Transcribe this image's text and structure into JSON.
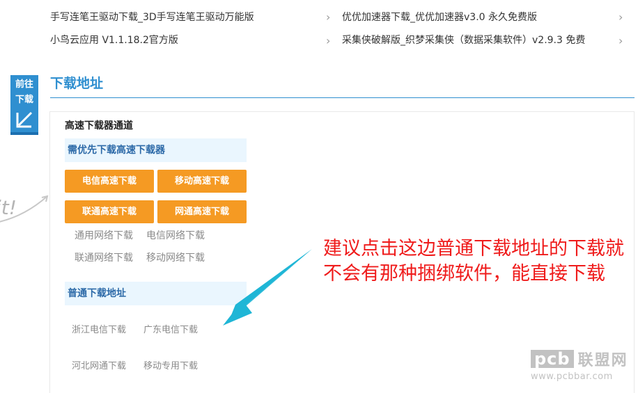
{
  "related_links": [
    {
      "label": "手写连笔王驱动下载_3D手写连笔王驱动万能版"
    },
    {
      "label": "优优加速器下载_优优加速器v3.0 永久免费版"
    },
    {
      "label": "小鸟云应用 V1.1.18.2官方版"
    },
    {
      "label": "采集侠破解版_织梦采集侠（数据采集软件）v2.9.3 免费"
    }
  ],
  "goto_badge": {
    "line1": "前往",
    "line2": "下载"
  },
  "section_title": "下载地址",
  "fast_channel": {
    "heading": "高速下载器通道",
    "band_label": "需优先下载高速下载器",
    "buttons": [
      "电信高速下载",
      "移动高速下载",
      "联通高速下载",
      "网通高速下载"
    ],
    "network_links": [
      "通用网络下载",
      "电信网络下载",
      "联通网络下载",
      "移动网络下载"
    ]
  },
  "normal_channel": {
    "band_label": "普通下载地址",
    "links": [
      "浙江电信下载",
      "广东电信下载",
      "河北网通下载",
      "移动专用下载"
    ]
  },
  "annotation": "建议点击这边普通下载地址的下载就不会有那种捆绑软件，能直接下载",
  "side_scribble_text": "it!",
  "watermark": {
    "logo": "pcb",
    "name": "联盟网",
    "url": "www.pcbbar.com"
  },
  "colors": {
    "accent_blue": "#2f8fd0",
    "orange_button": "#f59a23",
    "band_bg": "#eaf6fe",
    "annotation_red": "#ef1b1b",
    "arrow_cyan": "#1fb6d6"
  }
}
